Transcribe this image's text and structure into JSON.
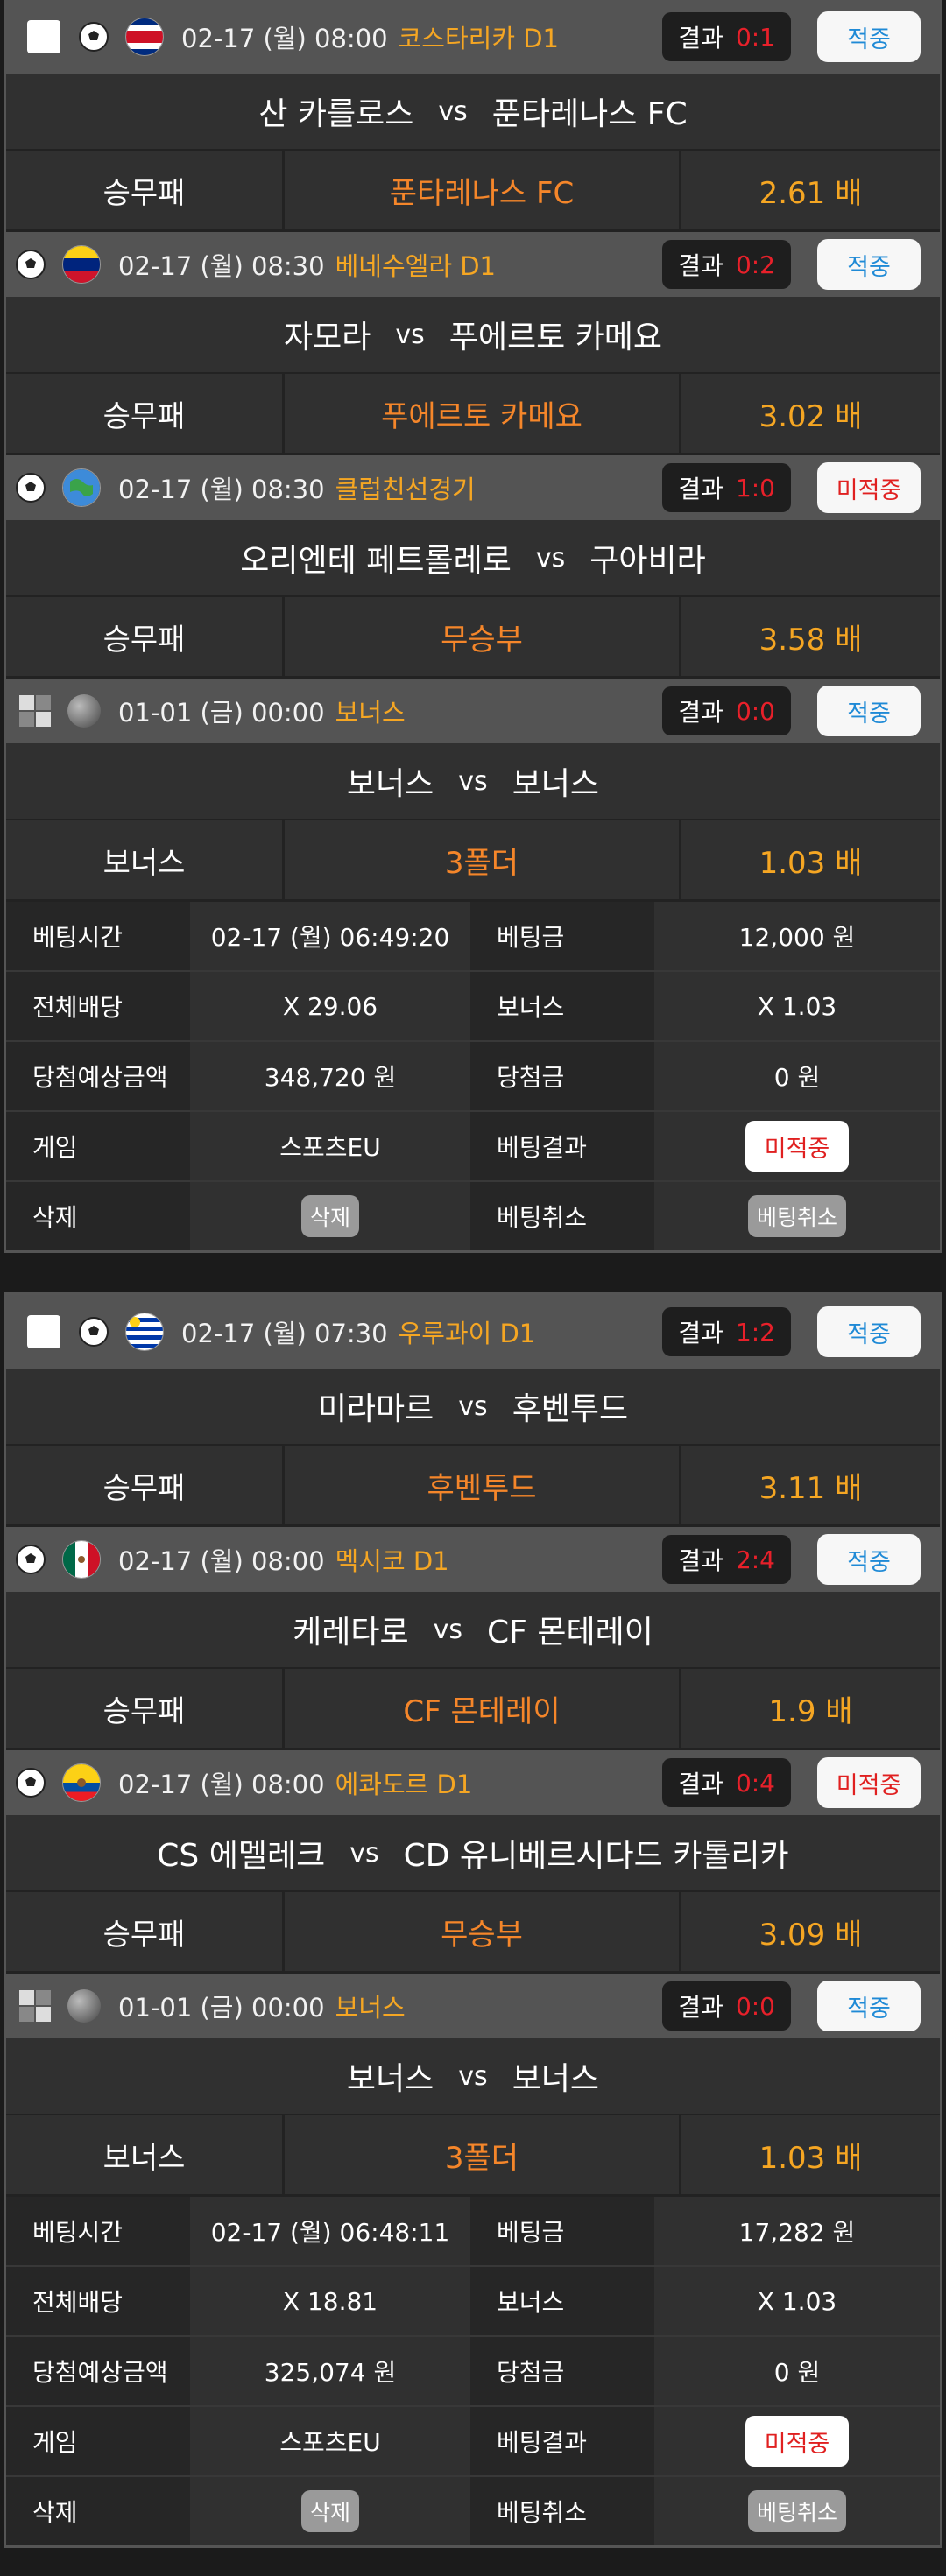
{
  "slips": [
    {
      "matches": [
        {
          "icon": "soccer-ball-icon",
          "flag": "costa-rica-flag",
          "date": "02-17 (월) 08:00",
          "league": "코스타리카 D1",
          "result_label": "결과",
          "score": "0:1",
          "status": "적중",
          "status_type": "hit",
          "home": "산 카를로스",
          "vs": "vs",
          "away": "푼타레나스 FC",
          "bet_type": "승무패",
          "pick": "푼타레나스 FC",
          "odds": "2.61 배"
        },
        {
          "icon": "soccer-ball-icon",
          "flag": "venezuela-flag",
          "date": "02-17 (월) 08:30",
          "league": "베네수엘라 D1",
          "result_label": "결과",
          "score": "0:2",
          "status": "적중",
          "status_type": "hit",
          "home": "자모라",
          "vs": "vs",
          "away": "푸에르토 카메요",
          "bet_type": "승무패",
          "pick": "푸에르토 카메요",
          "odds": "3.02 배"
        },
        {
          "icon": "soccer-ball-icon",
          "flag": "globe-icon",
          "date": "02-17 (월) 08:30",
          "league": "클럽친선경기",
          "result_label": "결과",
          "score": "1:0",
          "status": "미적중",
          "status_type": "miss",
          "home": "오리엔테 페트롤레로",
          "vs": "vs",
          "away": "구아비라",
          "bet_type": "승무패",
          "pick": "무승부",
          "odds": "3.58 배"
        },
        {
          "icon": "bonus-dice-icon",
          "flag": "bonus-ball-icon",
          "date": "01-01 (금) 00:00",
          "league": "보너스",
          "result_label": "결과",
          "score": "0:0",
          "status": "적중",
          "status_type": "hit",
          "home": "보너스",
          "vs": "vs",
          "away": "보너스",
          "bet_type": "보너스",
          "pick": "3폴더",
          "odds": "1.03 배"
        }
      ],
      "summary": {
        "bet_time_label": "베팅시간",
        "bet_time": "02-17 (월) 06:49:20",
        "bet_amount_label": "베팅금",
        "bet_amount": "12,000 원",
        "total_odds_label": "전체배당",
        "total_odds": "X 29.06",
        "bonus_label": "보너스",
        "bonus": "X 1.03",
        "expected_label": "당첨예상금액",
        "expected": "348,720 원",
        "win_label": "당첨금",
        "win": "0 원",
        "game_label": "게임",
        "game": "스포츠EU",
        "result_label": "베팅결과",
        "result": "미적중",
        "delete_label": "삭제",
        "delete_btn": "삭제",
        "cancel_label": "베팅취소",
        "cancel_btn": "베팅취소"
      }
    },
    {
      "matches": [
        {
          "icon": "soccer-ball-icon",
          "flag": "uruguay-flag",
          "date": "02-17 (월) 07:30",
          "league": "우루과이 D1",
          "result_label": "결과",
          "score": "1:2",
          "status": "적중",
          "status_type": "hit",
          "home": "미라마르",
          "vs": "vs",
          "away": "후벤투드",
          "bet_type": "승무패",
          "pick": "후벤투드",
          "odds": "3.11 배"
        },
        {
          "icon": "soccer-ball-icon",
          "flag": "mexico-flag",
          "date": "02-17 (월) 08:00",
          "league": "멕시코 D1",
          "result_label": "결과",
          "score": "2:4",
          "status": "적중",
          "status_type": "hit",
          "home": "케레타로",
          "vs": "vs",
          "away": "CF 몬테레이",
          "bet_type": "승무패",
          "pick": "CF 몬테레이",
          "odds": "1.9 배"
        },
        {
          "icon": "soccer-ball-icon",
          "flag": "ecuador-flag",
          "date": "02-17 (월) 08:00",
          "league": "에콰도르 D1",
          "result_label": "결과",
          "score": "0:4",
          "status": "미적중",
          "status_type": "miss",
          "home": "CS 에멜레크",
          "vs": "vs",
          "away": "CD 유니베르시다드 카톨리카",
          "bet_type": "승무패",
          "pick": "무승부",
          "odds": "3.09 배"
        },
        {
          "icon": "bonus-dice-icon",
          "flag": "bonus-ball-icon",
          "date": "01-01 (금) 00:00",
          "league": "보너스",
          "result_label": "결과",
          "score": "0:0",
          "status": "적중",
          "status_type": "hit",
          "home": "보너스",
          "vs": "vs",
          "away": "보너스",
          "bet_type": "보너스",
          "pick": "3폴더",
          "odds": "1.03 배"
        }
      ],
      "summary": {
        "bet_time_label": "베팅시간",
        "bet_time": "02-17 (월) 06:48:11",
        "bet_amount_label": "베팅금",
        "bet_amount": "17,282 원",
        "total_odds_label": "전체배당",
        "total_odds": "X 18.81",
        "bonus_label": "보너스",
        "bonus": "X 1.03",
        "expected_label": "당첨예상금액",
        "expected": "325,074 원",
        "win_label": "당첨금",
        "win": "0 원",
        "game_label": "게임",
        "game": "스포츠EU",
        "result_label": "베팅결과",
        "result": "미적중",
        "delete_label": "삭제",
        "delete_btn": "삭제",
        "cancel_label": "베팅취소",
        "cancel_btn": "베팅취소"
      }
    }
  ],
  "colors": {
    "league": "#f5a623",
    "pick": "#f5862a",
    "odds": "#f5a623",
    "score": "#e8202a",
    "hit": "#1f8ad6",
    "miss": "#e02020"
  }
}
